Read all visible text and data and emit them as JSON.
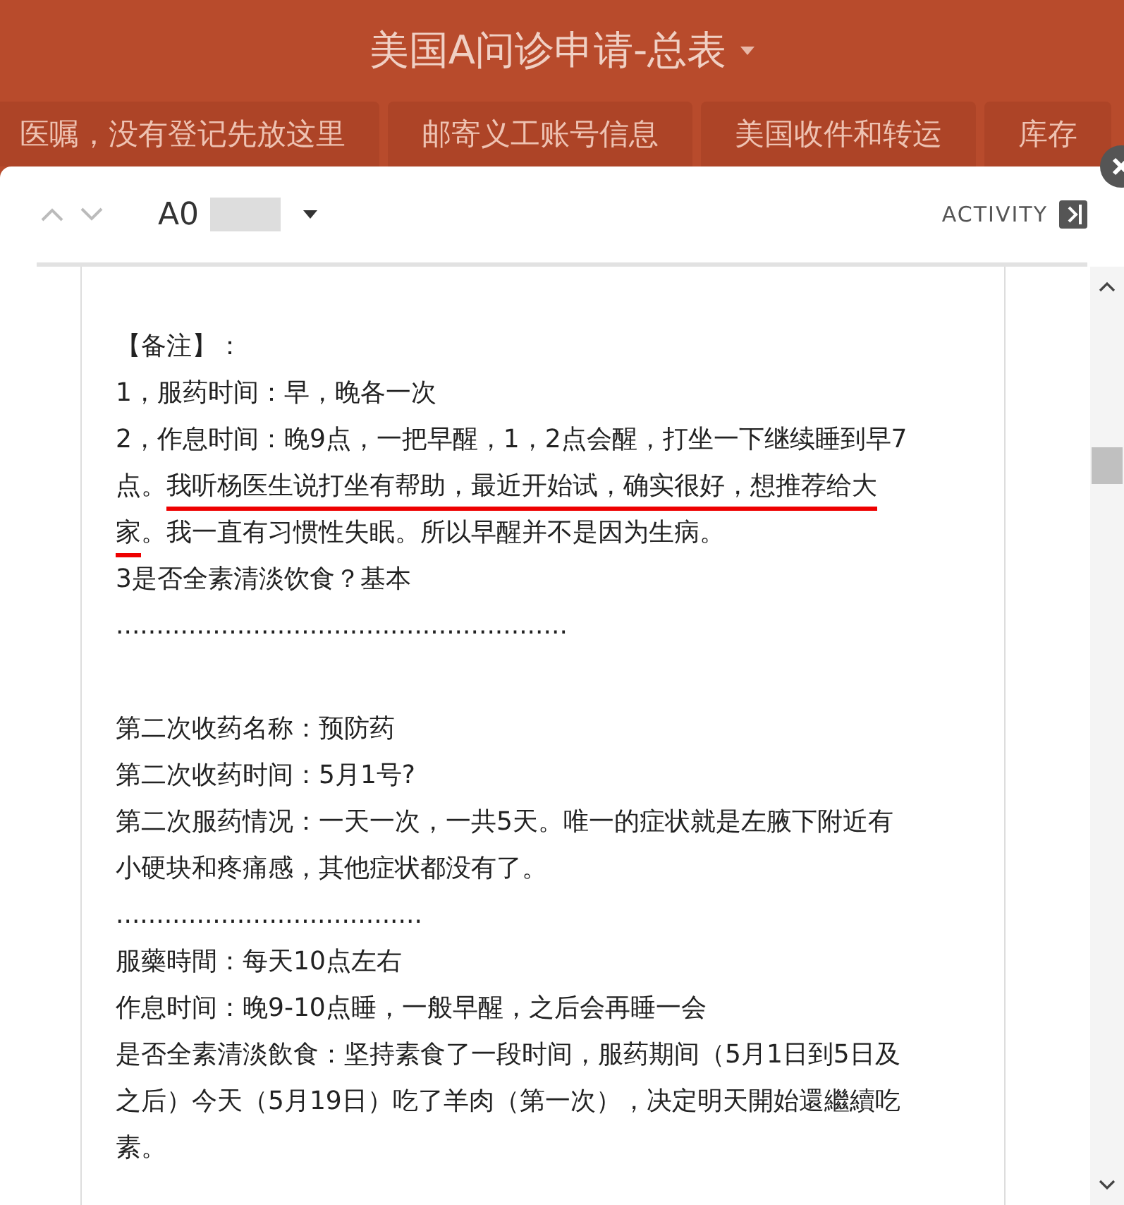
{
  "header": {
    "title": "美国A问诊申请-总表"
  },
  "tabs": [
    {
      "label": "医嘱，没有登记先放这里"
    },
    {
      "label": "邮寄义工账号信息"
    },
    {
      "label": "美国收件和转运"
    },
    {
      "label": "库存"
    }
  ],
  "record": {
    "id": "A0",
    "activity": "ACTIVITY"
  },
  "notes": [
    {
      "kind": "gap"
    },
    {
      "kind": "line",
      "segments": [
        {
          "text": "【备注】：",
          "underlined": false
        }
      ]
    },
    {
      "kind": "line",
      "segments": [
        {
          "text": "1，服药时间：早，晚各一次",
          "underlined": false
        }
      ]
    },
    {
      "kind": "line",
      "segments": [
        {
          "text": "2，作息时间：晚9点，一把早醒，1，2点会醒，打坐一下继续睡到早7",
          "underlined": false
        }
      ]
    },
    {
      "kind": "line",
      "segments": [
        {
          "text": "点。"
        },
        {
          "text": "我听杨医生说打坐有帮助，最近开始试，确实很好，想推荐给大",
          "underlined": true
        }
      ]
    },
    {
      "kind": "line",
      "segments": [
        {
          "text": "家",
          "underlined": true
        },
        {
          "text": "。我一直有习惯性失眠。所以早醒并不是因为生病。"
        }
      ]
    },
    {
      "kind": "line",
      "segments": [
        {
          "text": "3是否全素清淡饮食？基本",
          "underlined": false
        }
      ]
    },
    {
      "kind": "line",
      "segments": [
        {
          "text": "........................................................",
          "underlined": false
        }
      ]
    },
    {
      "kind": "gap"
    },
    {
      "kind": "line",
      "segments": [
        {
          "text": "第二次收药名称：预防药",
          "underlined": false
        }
      ]
    },
    {
      "kind": "line",
      "segments": [
        {
          "text": "第二次收药时间：5月1号?",
          "underlined": false
        }
      ]
    },
    {
      "kind": "line",
      "segments": [
        {
          "text": "第二次服药情况：一天一次，一共5天。唯一的症状就是左腋下附近有",
          "underlined": false
        }
      ]
    },
    {
      "kind": "line",
      "segments": [
        {
          "text": "小硬块和疼痛感，其他症状都没有了。",
          "underlined": false
        }
      ]
    },
    {
      "kind": "line",
      "segments": [
        {
          "text": "......................................",
          "underlined": false
        }
      ]
    },
    {
      "kind": "line",
      "segments": [
        {
          "text": "服藥時間：每天10点左右",
          "underlined": false
        }
      ]
    },
    {
      "kind": "line",
      "segments": [
        {
          "text": "作息时间：晚9-10点睡，一般早醒，之后会再睡一会",
          "underlined": false
        }
      ]
    },
    {
      "kind": "line",
      "segments": [
        {
          "text": "是否全素清淡飲食：坚持素食了一段时间，服药期间（5月1日到5日及",
          "underlined": false
        }
      ]
    },
    {
      "kind": "line",
      "segments": [
        {
          "text": "之后）今天（5月19日）吃了羊肉（第一次），决定明天開始還繼續吃",
          "underlined": false
        }
      ]
    },
    {
      "kind": "line",
      "segments": [
        {
          "text": "素。",
          "underlined": false
        }
      ]
    }
  ]
}
